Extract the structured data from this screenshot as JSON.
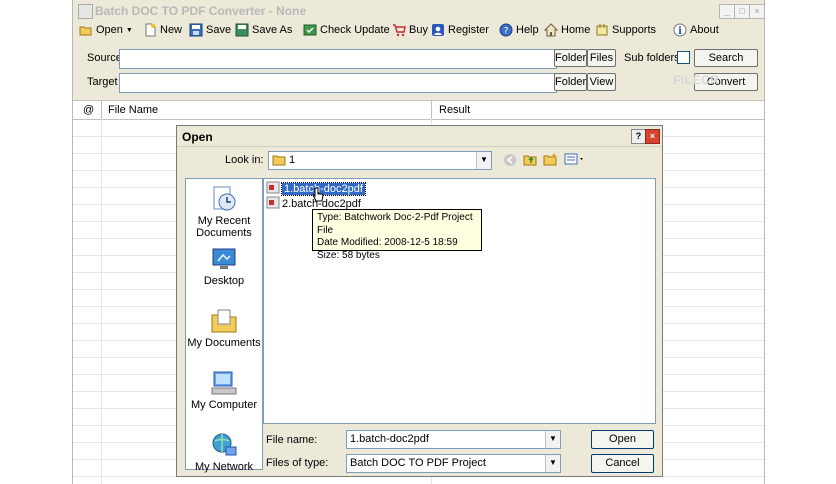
{
  "window": {
    "title": "Batch DOC TO PDF Converter - None"
  },
  "toolbar": {
    "items": [
      {
        "label": "Open",
        "icon": "folder-open-icon"
      },
      {
        "label": "New",
        "icon": "new-document-icon"
      },
      {
        "label": "Save",
        "icon": "save-icon"
      },
      {
        "label": "Save As",
        "icon": "save-as-icon"
      },
      {
        "label": "Check Update",
        "icon": "check-update-icon"
      },
      {
        "label": "Buy",
        "icon": "cart-icon"
      },
      {
        "label": "Register",
        "icon": "register-icon"
      },
      {
        "label": "Help",
        "icon": "help-icon"
      },
      {
        "label": "Home",
        "icon": "home-icon"
      },
      {
        "label": "Supports",
        "icon": "supports-icon"
      },
      {
        "label": "About",
        "icon": "about-icon"
      }
    ]
  },
  "source": {
    "label": "Source",
    "value": "",
    "folder_btn": "Folder",
    "files_btn": "Files",
    "subfolders_label": "Sub folders",
    "search_btn": "Search"
  },
  "target": {
    "label": "Target",
    "value": "",
    "folder_btn": "Folder",
    "view_btn": "View",
    "convert_btn": "Convert"
  },
  "watermark": "FILECR",
  "grid": {
    "columns": [
      "@",
      "File Name",
      "Result"
    ]
  },
  "dialog": {
    "title": "Open",
    "help_btn": "?",
    "close_btn": "×",
    "look_in_label": "Look in:",
    "look_in_value": "1",
    "places": [
      "My Recent Documents",
      "Desktop",
      "My Documents",
      "My Computer",
      "My Network"
    ],
    "files": [
      "1.batch-doc2pdf",
      "2.batch-doc2pdf"
    ],
    "tooltip": {
      "type": "Type: Batchwork Doc-2-Pdf Project File",
      "modified": "Date Modified: 2008-12-5 18:59",
      "size": "Size: 58 bytes"
    },
    "file_name_label": "File name:",
    "file_name_value": "1.batch-doc2pdf",
    "files_of_type_label": "Files of type:",
    "files_of_type_value": "Batch DOC TO PDF Project",
    "open_btn": "Open",
    "cancel_btn": "Cancel"
  }
}
